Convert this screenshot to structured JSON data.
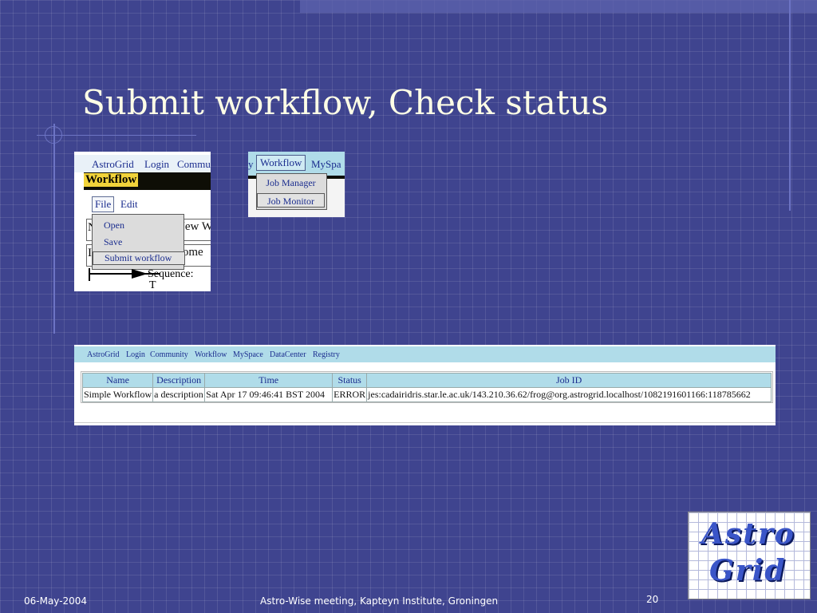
{
  "slide": {
    "title": "Submit workflow, Check status",
    "footer_date": "06-May-2004",
    "footer_center": "Astro-Wise meeting, Kapteyn Institute, Groningen",
    "page_number": "20"
  },
  "shot1": {
    "nav": [
      "AstroGrid",
      "Login",
      "Commu"
    ],
    "banner": "Workflow",
    "menu_file": "File",
    "menu_edit": "Edit",
    "dropdown": [
      "Open",
      "Save",
      "Submit workflow"
    ],
    "bg_text_1": "New W",
    "bg_text_2": "some",
    "bg_label_1": "N",
    "bg_label_2": "I",
    "sequence_label": "Sequence:",
    "t_mark": "T"
  },
  "shot2": {
    "nav_left": "y",
    "nav_workflow": "Workflow",
    "nav_right": "MySpa",
    "dropdown": [
      "Job Manager",
      "Job Monitor"
    ]
  },
  "shot3": {
    "nav": [
      "AstroGrid",
      "Login",
      "Community",
      "Workflow",
      "MySpace",
      "DataCenter",
      "Registry"
    ],
    "columns": [
      "Name",
      "Description",
      "Time",
      "Status",
      "Job ID"
    ],
    "row": [
      "Simple Workflow",
      "a description",
      "Sat Apr 17 09:46:41 BST 2004",
      "ERROR",
      "jes:cadairidris.star.le.ac.uk/143.210.36.62/frog@org.astrogrid.localhost/1082191601166:118785662"
    ]
  },
  "logo": {
    "line1": "Astro",
    "line2": "Grid"
  },
  "colors": {
    "background": "#3f448f",
    "title": "#ffffe6",
    "table_header": "#b0dce9",
    "link": "#1a2c8e"
  }
}
